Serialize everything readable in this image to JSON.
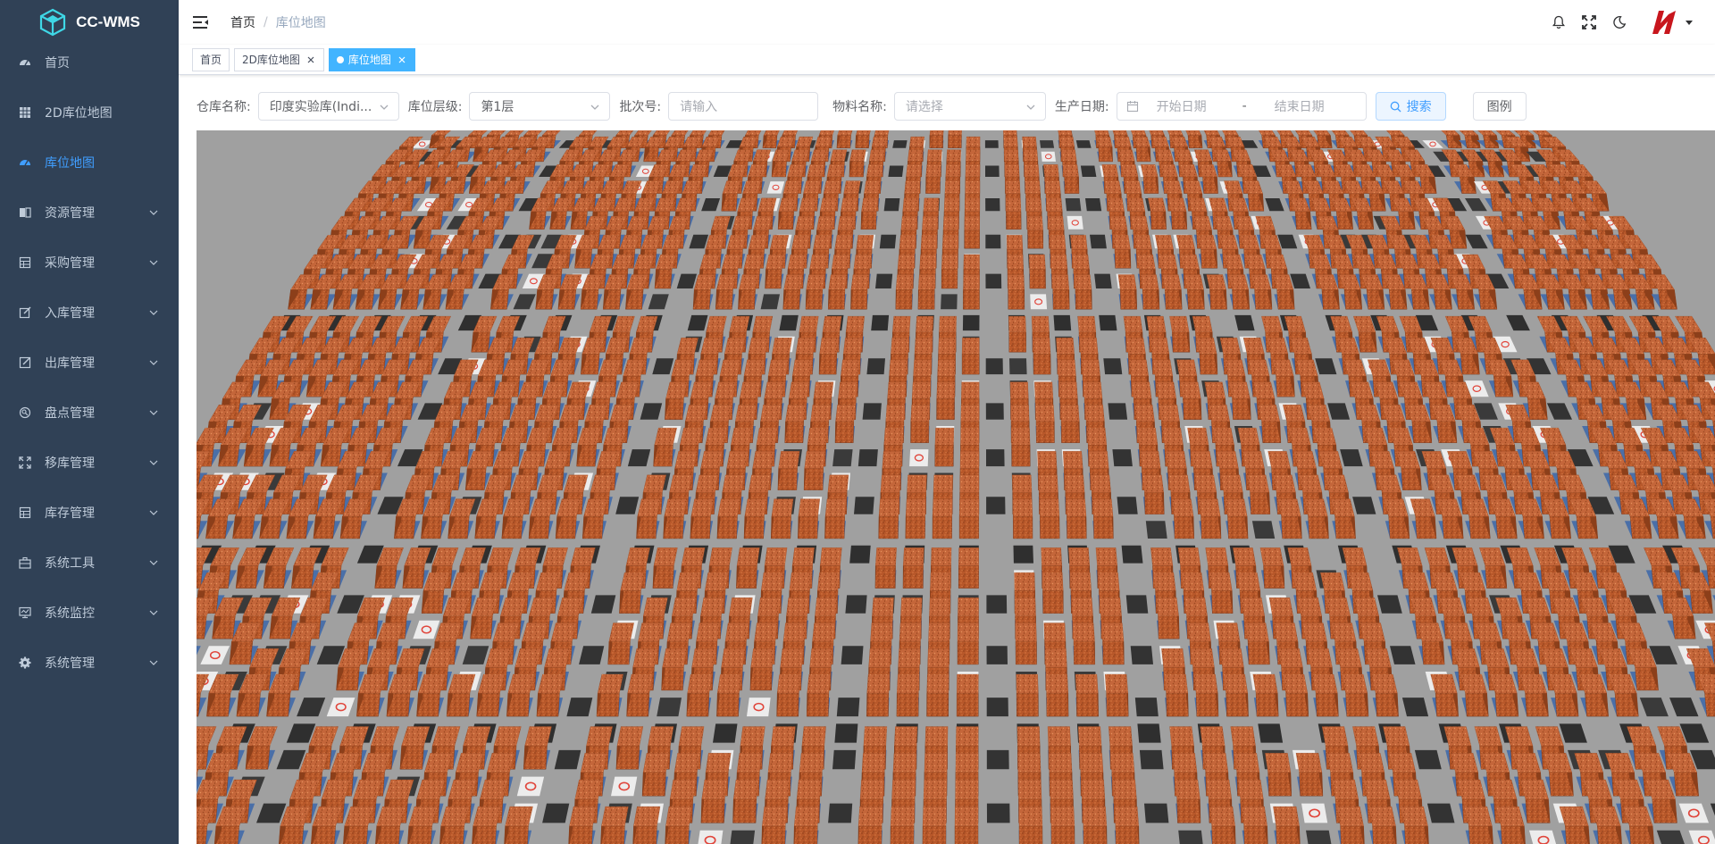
{
  "app": {
    "title": "CC-WMS"
  },
  "sidebar": {
    "items": [
      {
        "label": "首页",
        "icon": "dashboard-icon",
        "expandable": false,
        "active": false
      },
      {
        "label": "2D库位地图",
        "icon": "grid-icon",
        "expandable": false,
        "active": false
      },
      {
        "label": "库位地图",
        "icon": "dashboard-icon",
        "expandable": false,
        "active": true
      },
      {
        "label": "资源管理",
        "icon": "resource-icon",
        "expandable": true,
        "active": false
      },
      {
        "label": "采购管理",
        "icon": "table-icon",
        "expandable": true,
        "active": false
      },
      {
        "label": "入库管理",
        "icon": "edit-icon",
        "expandable": true,
        "active": false
      },
      {
        "label": "出库管理",
        "icon": "form-icon",
        "expandable": true,
        "active": false
      },
      {
        "label": "盘点管理",
        "icon": "stocktake-icon",
        "expandable": true,
        "active": false
      },
      {
        "label": "移库管理",
        "icon": "move-icon",
        "expandable": true,
        "active": false
      },
      {
        "label": "库存管理",
        "icon": "table-icon",
        "expandable": true,
        "active": false
      },
      {
        "label": "系统工具",
        "icon": "toolbox-icon",
        "expandable": true,
        "active": false
      },
      {
        "label": "系统监控",
        "icon": "monitor-icon",
        "expandable": true,
        "active": false
      },
      {
        "label": "系统管理",
        "icon": "gear-icon",
        "expandable": true,
        "active": false
      }
    ]
  },
  "breadcrumb": {
    "home": "首页",
    "separator": "/",
    "current": "库位地图"
  },
  "tags": [
    {
      "label": "首页",
      "closable": false,
      "active": false
    },
    {
      "label": "2D库位地图",
      "closable": true,
      "active": false
    },
    {
      "label": "库位地图",
      "closable": true,
      "active": true
    }
  ],
  "filter": {
    "warehouse_label": "仓库名称:",
    "warehouse_value": "印度实验库(Indi...",
    "level_label": "库位层级:",
    "level_value": "第1层",
    "batch_label": "批次号:",
    "batch_placeholder": "请输入",
    "material_label": "物料名称:",
    "material_placeholder": "请选择",
    "date_label": "生产日期:",
    "date_start_placeholder": "开始日期",
    "date_separator": "-",
    "date_end_placeholder": "结束日期",
    "search_button": "搜索",
    "legend_button": "图例"
  },
  "colors": {
    "sidebar_bg": "#304156",
    "sidebar_text": "#bfcbd9",
    "active": "#409eff",
    "tag_active": "#42b4ff",
    "floor": "#a0a0a0",
    "rack": "#b8582a",
    "dark_slot": "#333333",
    "forbidden": "#e0463c"
  }
}
